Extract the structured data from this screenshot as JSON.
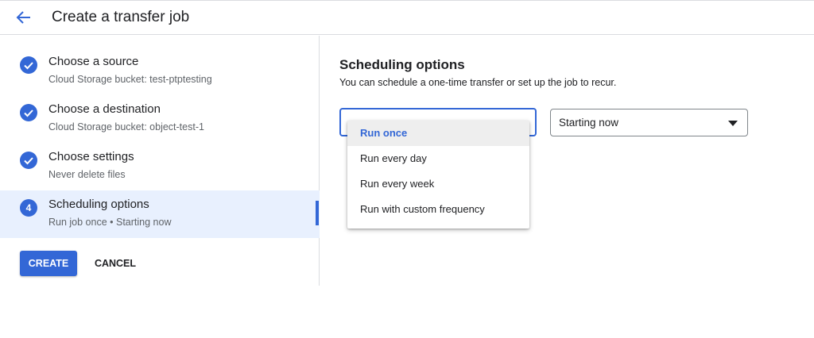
{
  "header": {
    "title": "Create a transfer job",
    "back_icon": "arrow-back-icon"
  },
  "steps": [
    {
      "title": "Choose a source",
      "subtitle": "Cloud Storage bucket: test-ptptesting",
      "status": "complete",
      "icon": "check-circle-icon"
    },
    {
      "title": "Choose a destination",
      "subtitle": "Cloud Storage bucket: object-test-1",
      "status": "complete",
      "icon": "check-circle-icon"
    },
    {
      "title": "Choose settings",
      "subtitle": "Never delete files",
      "status": "complete",
      "icon": "check-circle-icon"
    },
    {
      "title": "Scheduling options",
      "subtitle": "Run job once • Starting now",
      "status": "active",
      "number": "4"
    }
  ],
  "actions": {
    "create_label": "CREATE",
    "cancel_label": "CANCEL"
  },
  "scheduling": {
    "title": "Scheduling options",
    "description": "You can schedule a one-time transfer or set up the job to recur.",
    "frequency_options": [
      "Run once",
      "Run every day",
      "Run every week",
      "Run with custom frequency"
    ],
    "frequency_selected": "Run once",
    "start_value": "Starting now"
  },
  "colors": {
    "accent": "#3367d6",
    "active_step_bg": "#e8f0fe",
    "text": "#202124",
    "muted": "#5f6368"
  }
}
